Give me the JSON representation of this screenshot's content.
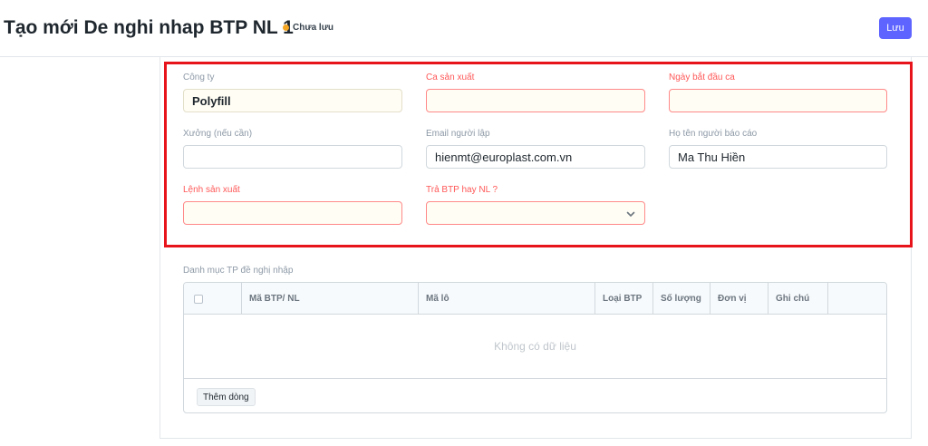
{
  "header": {
    "title": "Tạo mới De nghi nhap BTP NL 1",
    "status": "Chưa lưu",
    "status_color": "#f5a623",
    "save_label": "Lưu",
    "accent_color": "#5e64ff"
  },
  "form": {
    "company": {
      "label": "Công ty",
      "value": "Polyfill"
    },
    "shift": {
      "label": "Ca sản xuất",
      "value": ""
    },
    "shift_start_date": {
      "label": "Ngày bắt đầu ca",
      "value": ""
    },
    "workshop": {
      "label": "Xưởng (nếu cần)",
      "value": ""
    },
    "creator_email": {
      "label": "Email người lập",
      "value": "hienmt@europlast.com.vn"
    },
    "reporter_name": {
      "label": "Họ tên người báo cáo",
      "value": "Ma Thu Hiền"
    },
    "production_order": {
      "label": "Lệnh sản xuất",
      "value": ""
    },
    "return_type": {
      "label": "Trả BTP hay NL ?",
      "value": "",
      "icon": "chevron-down-icon"
    }
  },
  "table": {
    "section_label": "Danh mục TP đề nghị nhập",
    "columns": [
      "Mã BTP/ NL",
      "Mã lô",
      "Loại BTP",
      "Số lượng",
      "Đơn vị",
      "Ghi chú"
    ],
    "empty_text": "Không có dữ liệu",
    "add_row_label": "Thêm dòng"
  },
  "highlight_color": "#e8141b"
}
